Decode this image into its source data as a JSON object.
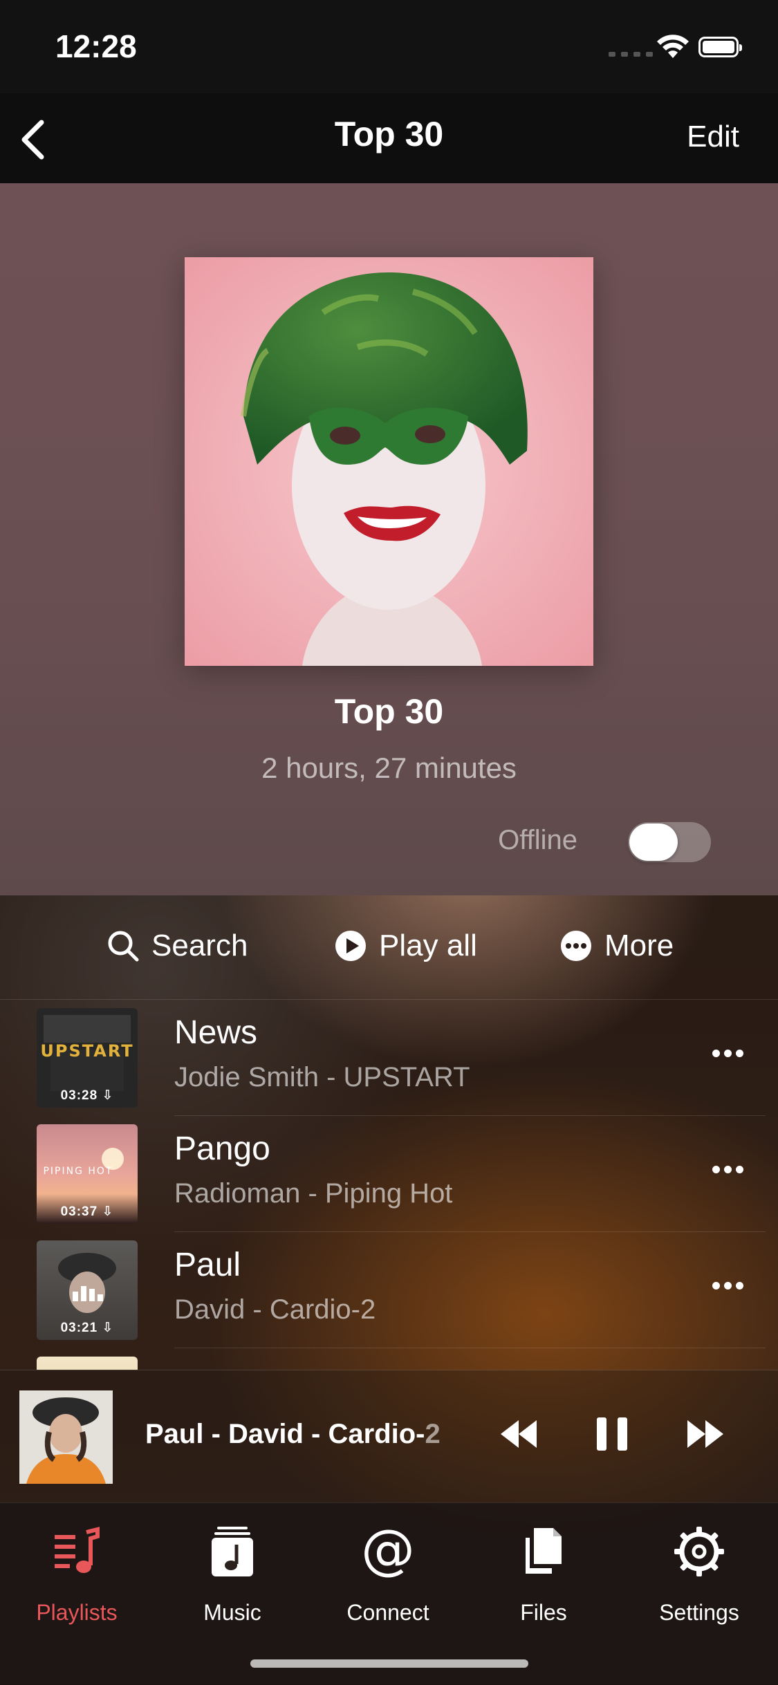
{
  "status_bar": {
    "time": "12:28"
  },
  "nav": {
    "title": "Top 30",
    "edit_label": "Edit",
    "back_icon": "chevron-left-icon"
  },
  "playlist": {
    "title": "Top 30",
    "duration": "2 hours, 27 minutes",
    "offline_label": "Offline",
    "offline_enabled": false
  },
  "actions": {
    "search": "Search",
    "play_all": "Play all",
    "more": "More"
  },
  "tracks": [
    {
      "title": "News",
      "subtitle": "Jodie Smith - UPSTART",
      "duration": "03:28 ⇩",
      "art_text": "UPSTART"
    },
    {
      "title": "Pango",
      "subtitle": "Radioman - Piping Hot",
      "duration": "03:37 ⇩",
      "art_text": "PIPING HOT"
    },
    {
      "title": "Paul",
      "subtitle": "David - Cardio-2",
      "duration": "03:21 ⇩",
      "playing": true
    }
  ],
  "now_playing": {
    "title_main": "Paul - David - Cardio-",
    "title_fade": "2"
  },
  "tabs": [
    {
      "label": "Playlists",
      "icon": "playlist-icon",
      "active": true
    },
    {
      "label": "Music",
      "icon": "music-note-icon"
    },
    {
      "label": "Connect",
      "icon": "at-sign-icon"
    },
    {
      "label": "Files",
      "icon": "files-icon"
    },
    {
      "label": "Settings",
      "icon": "gear-icon"
    }
  ],
  "colors": {
    "accent": "#e8575a",
    "header_bg": "#6a4f52"
  }
}
